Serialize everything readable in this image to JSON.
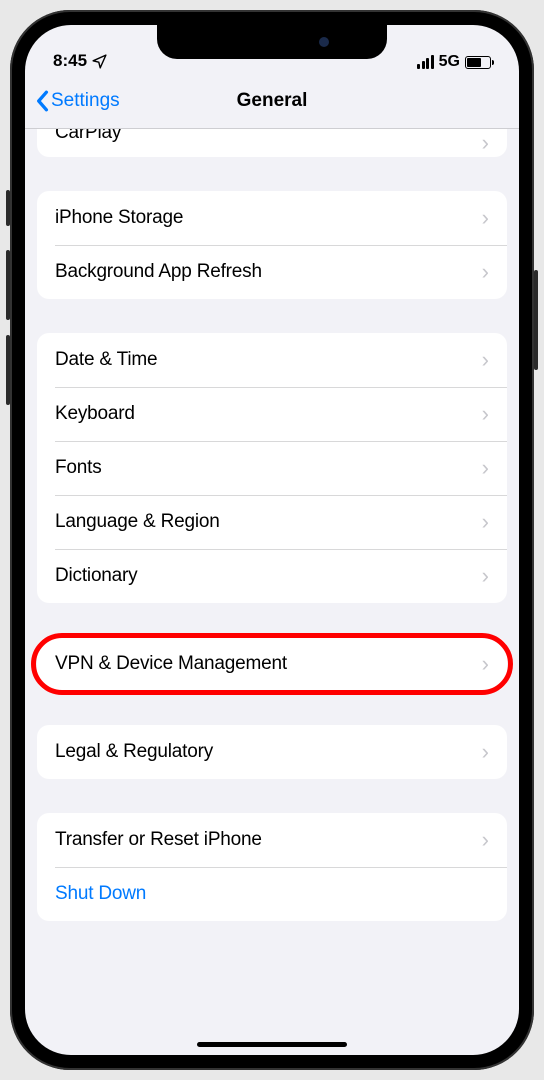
{
  "status": {
    "time": "8:45",
    "network": "5G"
  },
  "nav": {
    "back": "Settings",
    "title": "General"
  },
  "groups": {
    "g0": {
      "carplay": "CarPlay"
    },
    "g1": {
      "storage": "iPhone Storage",
      "bgrefresh": "Background App Refresh"
    },
    "g2": {
      "datetime": "Date & Time",
      "keyboard": "Keyboard",
      "fonts": "Fonts",
      "language": "Language & Region",
      "dictionary": "Dictionary"
    },
    "g3": {
      "vpn": "VPN & Device Management"
    },
    "g4": {
      "legal": "Legal & Regulatory"
    },
    "g5": {
      "transfer": "Transfer or Reset iPhone",
      "shutdown": "Shut Down"
    }
  }
}
